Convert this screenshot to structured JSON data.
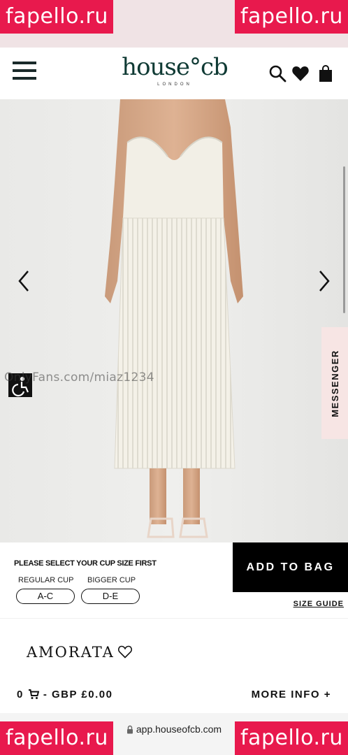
{
  "watermarks": {
    "top_left": "fapello.ru",
    "top_right": "fapello.ru",
    "bottom_left": "fapello.ru",
    "bottom_right": "fapello.ru",
    "overlay": "OnlyFans.com/miaz1234"
  },
  "header": {
    "logo_main": "house°cb",
    "logo_sub": "LONDON",
    "icons": [
      "hamburger-icon",
      "search-icon",
      "heart-icon",
      "shopping-bag-icon"
    ]
  },
  "hero": {
    "image": "white pleated strapless corset midi dress on model",
    "prev_icon": "chevron-left-icon",
    "next_icon": "chevron-right-icon",
    "messenger_label": "MESSENGER"
  },
  "cup": {
    "title": "PLEASE SELECT YOUR CUP SIZE FIRST",
    "regular_label": "REGULAR CUP",
    "bigger_label": "BIGGER CUP",
    "regular_option": "A-C",
    "bigger_option": "D-E"
  },
  "actions": {
    "add_to_bag": "ADD TO BAG",
    "size_guide": "SIZE GUIDE"
  },
  "product": {
    "name": "AMORATA",
    "cart_count": "0",
    "price_sep": "-",
    "price": "GBP £0.00",
    "more_info": "MORE INFO +"
  },
  "browser": {
    "url": "app.houseofcb.com"
  },
  "colors": {
    "watermark_bg": "#e8194d",
    "logo": "#0f3a34",
    "hero_bg": "#ebebea",
    "messenger_bg": "#f7e5e4",
    "button_bg": "#000000"
  }
}
